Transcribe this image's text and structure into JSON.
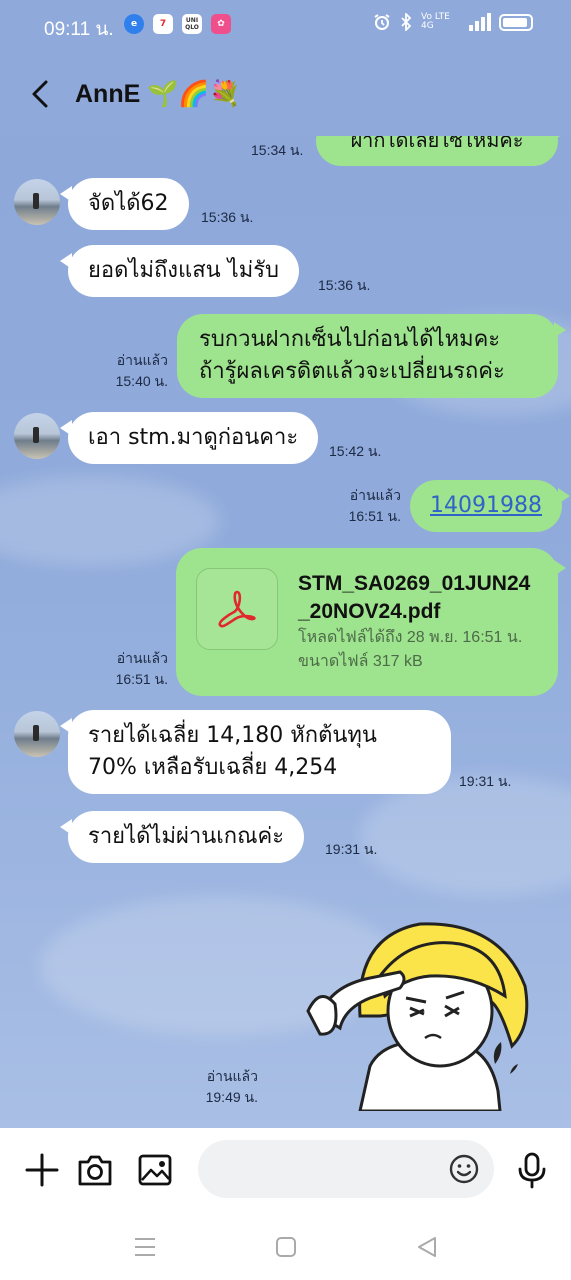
{
  "status_bar": {
    "time": "09:11 น.",
    "app_icons": [
      "edge-browser-icon",
      "seven-eleven-icon",
      "uniqlo-icon",
      "pink-app-icon"
    ],
    "app_labels": [
      "",
      "7",
      "UNI QLO",
      "✿"
    ],
    "network": "Vo LTE 4G"
  },
  "header": {
    "contact_name": "AnnE 🌱🌈💐",
    "icons": [
      "back-arrow-icon",
      "search-icon",
      "phone-icon",
      "menu-icon"
    ]
  },
  "messages": [
    {
      "id": "m0",
      "side": "out",
      "text": "ฝากได้เลยไซ้ไหมคะ",
      "time": "15:34 น.",
      "read": ""
    },
    {
      "id": "m1",
      "side": "in",
      "text": "จัดได้62",
      "time": "15:36 น."
    },
    {
      "id": "m2",
      "side": "in",
      "text": "ยอดไม่ถึงแสน ไม่รับ",
      "time": "15:36 น."
    },
    {
      "id": "m3",
      "side": "out",
      "line1": "รบกวนฝากเซ็นไปก่อนได้ไหมคะ",
      "line2": "ถ้ารู้ผลเครดิตแล้วจะเปลี่ยนรถค่ะ",
      "time": "15:40 น.",
      "read": "อ่านแล้ว"
    },
    {
      "id": "m4",
      "side": "in",
      "text": "เอา stm.มาดูก่อนคาะ",
      "time": "15:42 น."
    },
    {
      "id": "m5",
      "side": "out",
      "text": "14091988",
      "time": "16:51 น.",
      "read": "อ่านแล้ว"
    },
    {
      "id": "m6",
      "side": "out",
      "type": "file",
      "file_name_1": "STM_SA0269_01JUN24",
      "file_name_2": "_20NOV24.pdf",
      "download_info": "โหลดไฟล์ได้ถึง 28 พ.ย. 16:51 น.",
      "size_info": "ขนาดไฟล์ 317 kB",
      "time": "16:51 น.",
      "read": "อ่านแล้ว"
    },
    {
      "id": "m7",
      "side": "in",
      "line1": "รายได้เฉลี่ย 14,180 หักต้นทุน",
      "line2": "70% เหลือรับเฉลี่ย 4,254",
      "time": "19:31 น."
    },
    {
      "id": "m8",
      "side": "in",
      "text": "รายได้ไม่ผ่านเกณค่ะ",
      "time": "19:31 น."
    },
    {
      "id": "m9",
      "side": "out",
      "type": "sticker",
      "sticker": "salute-blonde-character-sticker",
      "time": "19:49 น.",
      "read": "อ่านแล้ว"
    }
  ],
  "input_bar": {
    "placeholder": "",
    "icons": [
      "plus-icon",
      "camera-icon",
      "image-icon",
      "emoji-icon",
      "microphone-icon"
    ]
  },
  "nav_bar": {
    "icons": [
      "recent-apps-icon",
      "home-icon",
      "back-icon"
    ]
  },
  "colors": {
    "chat_background": "#8fa9db",
    "outgoing_bubble": "#9ee38e",
    "incoming_bubble": "#ffffff",
    "link": "#2f63c9",
    "pdf_icon": "#e0282e"
  }
}
